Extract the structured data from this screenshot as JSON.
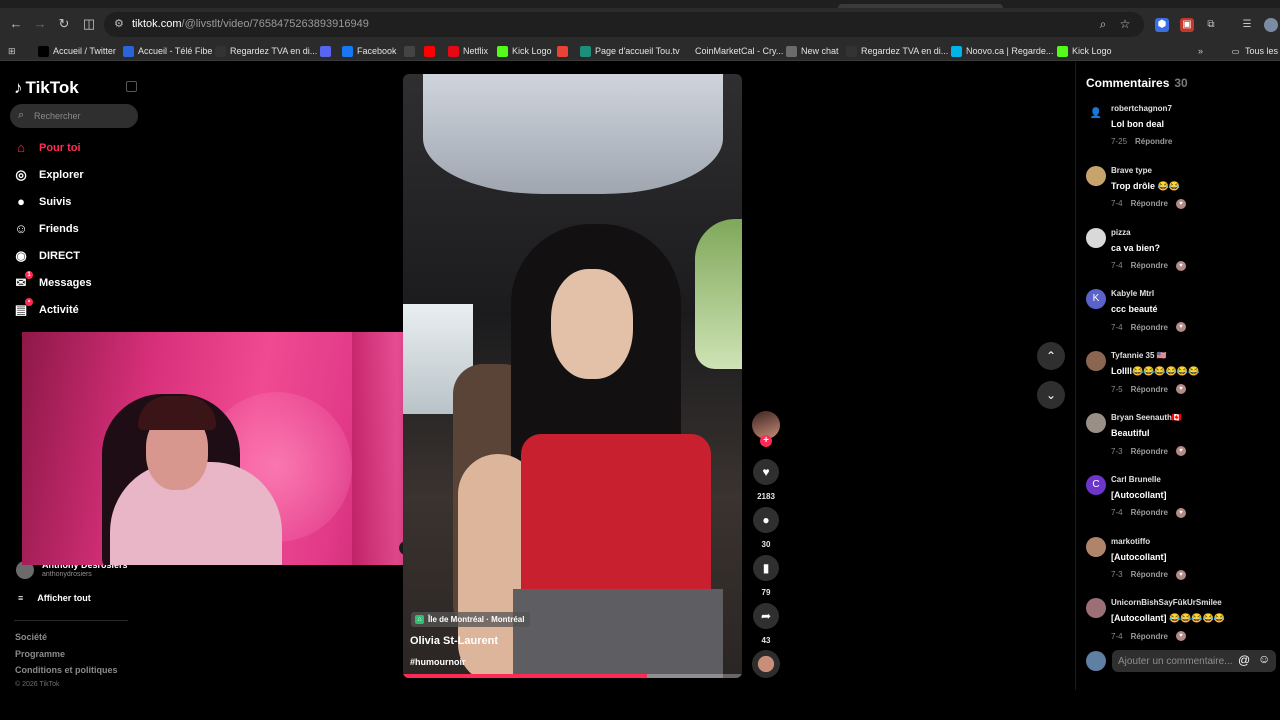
{
  "browser": {
    "url_host": "tiktok.com",
    "url_path": "/@livstlt/video/7658475263893916949",
    "bookmarks": [
      {
        "label": "Accueil / Twitter",
        "icon": "x-icon",
        "color": "#000000"
      },
      {
        "label": "Accueil - Télé Fibe",
        "icon": "fibe-icon",
        "color": "#2b63d9"
      },
      {
        "label": "Regardez TVA en di...",
        "icon": "tva-icon",
        "color": "#333333"
      },
      {
        "label": "",
        "icon": "discord-icon",
        "color": "#5865f2"
      },
      {
        "label": "Facebook",
        "icon": "facebook-icon",
        "color": "#1877f2"
      },
      {
        "label": "",
        "icon": "s-icon",
        "color": "#444444"
      },
      {
        "label": "",
        "icon": "youtube-icon",
        "color": "#ff0000"
      },
      {
        "label": "Netflix",
        "icon": "netflix-icon",
        "color": "#e50914"
      },
      {
        "label": "Kick Logo",
        "icon": "kick-icon",
        "color": "#53fc18"
      },
      {
        "label": "",
        "icon": "gmail-icon",
        "color": "#ea4335"
      },
      {
        "label": "Page d'accueil Tou.tv",
        "icon": "toutv-icon",
        "color": "#1a8f7a"
      },
      {
        "label": "CoinMarketCal - Cry...",
        "icon": "coinmarketcal-icon",
        "color": "#2b2b2b"
      },
      {
        "label": "New chat",
        "icon": "chatgpt-icon",
        "color": "#6b6b6b"
      },
      {
        "label": "Regardez TVA en di...",
        "icon": "tva-icon",
        "color": "#333333"
      },
      {
        "label": "Noovo.ca | Regarde...",
        "icon": "noovo-icon",
        "color": "#00b4e6"
      },
      {
        "label": "Kick Logo",
        "icon": "kick-icon",
        "color": "#53fc18"
      }
    ],
    "all_bookmarks": "Tous les"
  },
  "sidebar": {
    "logo": "TikTok",
    "search_placeholder": "Rechercher",
    "nav": [
      {
        "label": "Pour toi",
        "icon": "home-icon",
        "active": true
      },
      {
        "label": "Explorer",
        "icon": "compass-icon",
        "active": false
      },
      {
        "label": "Suivis",
        "icon": "following-icon",
        "active": false
      },
      {
        "label": "Friends",
        "icon": "friends-icon",
        "active": false
      },
      {
        "label": "DIRECT",
        "icon": "live-icon",
        "active": false
      },
      {
        "label": "Messages",
        "icon": "messages-icon",
        "active": false,
        "badge": "1"
      },
      {
        "label": "Activité",
        "icon": "activity-icon",
        "active": false,
        "badge": "•"
      }
    ],
    "followed_account": {
      "name": "Anthony Desrosiers",
      "handle": "anthonydrosiers"
    },
    "show_all": "Afficher tout",
    "footer": [
      "Société",
      "Programme",
      "Conditions et politiques"
    ],
    "copyright": "© 2026 TikTok"
  },
  "video": {
    "location": "Île de Montréal · Montréal",
    "author": "Olivia St-Laurent",
    "hashtag": "#humournoir",
    "progress": 0.72
  },
  "actions": {
    "likes": "2183",
    "comments": "30",
    "saves": "79",
    "shares": "43"
  },
  "comments": {
    "title": "Commentaires",
    "count": "30",
    "reply_label": "Répondre",
    "input_placeholder": "Ajouter un commentaire...",
    "items": [
      {
        "user": "robertchagnon7",
        "text": "Lol bon deal",
        "date": "7-25",
        "avatar": "",
        "color": "#000000",
        "heart": false
      },
      {
        "user": "Brave type",
        "text": "Trop drôle 😂😂",
        "date": "7-4",
        "avatar": "",
        "color": "#c7a46b",
        "heart": true
      },
      {
        "user": "pizza",
        "text": "ca va bien?",
        "date": "7-4",
        "avatar": "",
        "color": "#d9d9d9",
        "heart": true
      },
      {
        "user": "Kabyle Mtrl",
        "text": "ccc beauté",
        "date": "7-4",
        "avatar": "K",
        "color": "#5a63c9",
        "heart": true
      },
      {
        "user": "Tyfannie 35 🇺🇸",
        "text": "Lollll😂😂😂😂😂😂",
        "date": "7-5",
        "avatar": "",
        "color": "#8a6650",
        "heart": true
      },
      {
        "user": "Bryan Seenauth🇨🇦",
        "text": "Beautiful",
        "date": "7-3",
        "avatar": "",
        "color": "#9a8f86",
        "heart": true
      },
      {
        "user": "Carl Brunelle",
        "text": "[Autocollant]",
        "date": "7-4",
        "avatar": "C",
        "color": "#6d35c9",
        "heart": true
      },
      {
        "user": "markotiffo",
        "text": "[Autocollant]",
        "date": "7-3",
        "avatar": "",
        "color": "#b0846a",
        "heart": true
      },
      {
        "user": "UnicornBishSayFûkUrSmilee",
        "text": "[Autocollant] 😂😂😂😂😂",
        "date": "7-4",
        "avatar": "",
        "color": "#9c6f77",
        "heart": true
      }
    ]
  }
}
